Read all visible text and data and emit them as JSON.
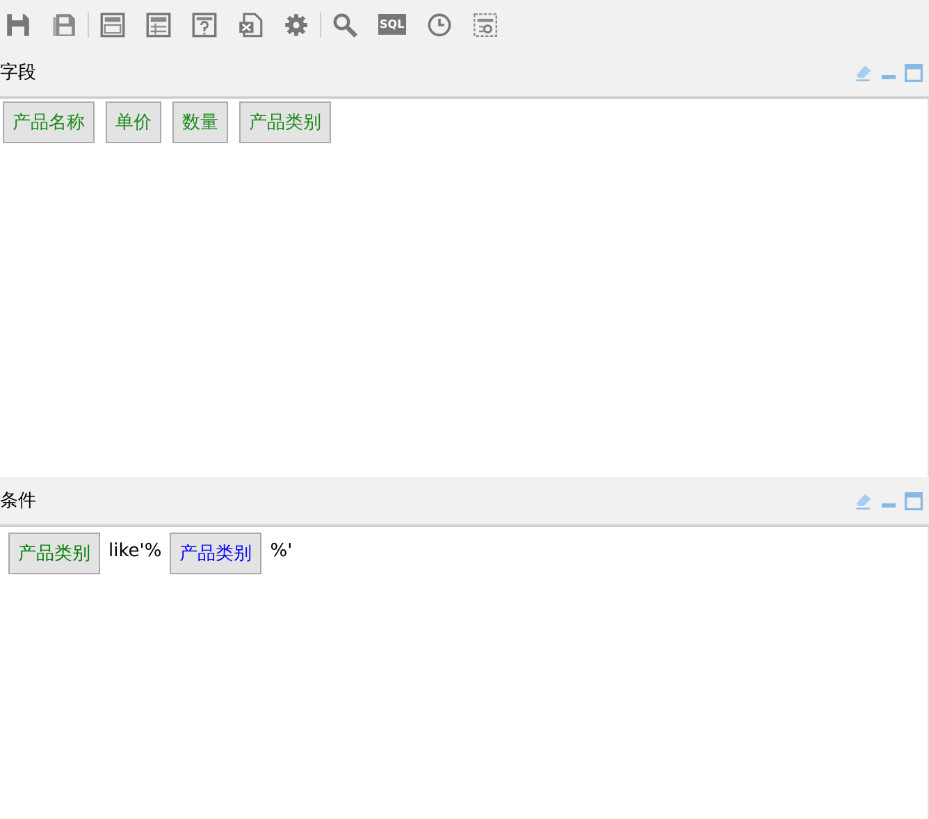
{
  "toolbar": {
    "sql_label": "SQL"
  },
  "fields_panel": {
    "title": "字段",
    "fields": [
      "产品名称",
      "单价",
      "数量",
      "产品类别"
    ]
  },
  "conditions_panel": {
    "title": "条件",
    "tokens": [
      {
        "kind": "field",
        "text": "产品类别",
        "color": "#008000"
      },
      {
        "kind": "text",
        "text": "like'%"
      },
      {
        "kind": "field",
        "text": "产品类别",
        "color": "#0000ff"
      },
      {
        "kind": "text",
        "text": "%'"
      }
    ]
  }
}
